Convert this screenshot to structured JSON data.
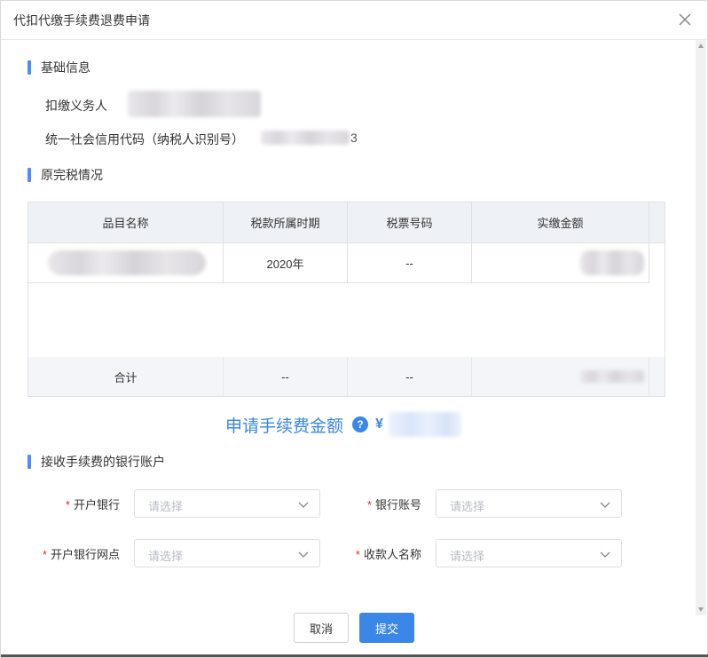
{
  "dialog": {
    "title": "代扣代缴手续费退费申请"
  },
  "basic_info": {
    "section_title": "基础信息",
    "withholding_agent_label": "扣缴义务人",
    "credit_code_label": "统一社会信用代码（纳税人识别号）",
    "credit_code_suffix": "3"
  },
  "tax_info": {
    "section_title": "原完税情况",
    "columns": [
      "品目名称",
      "税款所属时期",
      "税票号码",
      "实缴金额"
    ],
    "rows": [
      {
        "period": "2020年",
        "ticket_no": "--"
      }
    ],
    "footer": {
      "label": "合计",
      "period": "--",
      "ticket_no": "--"
    }
  },
  "fee": {
    "label": "申请手续费金额",
    "help_icon": "?",
    "currency": "¥"
  },
  "bank": {
    "section_title": "接收手续费的银行账户",
    "required_mark": "*",
    "bank_label": "开户银行",
    "account_label": "银行账号",
    "branch_label": "开户银行网点",
    "payee_label": "收款人名称",
    "placeholder": "请选择"
  },
  "actions": {
    "cancel": "取消",
    "submit": "提交"
  },
  "colors": {
    "accent": "#3a87e8",
    "required": "#f5222d"
  }
}
